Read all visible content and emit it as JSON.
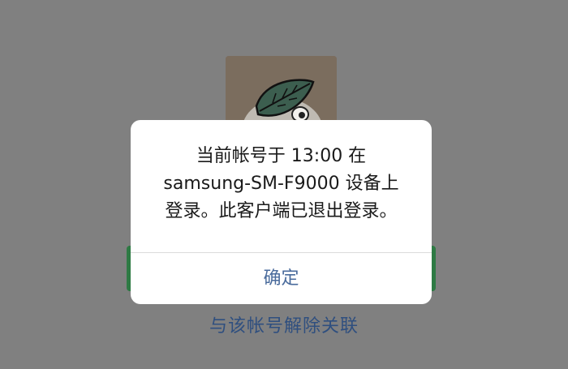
{
  "dialog": {
    "message_lines": [
      "当前帐号于 13:00 在",
      "samsung-SM-F9000 设备上",
      "登录。此客户端已退出登录。"
    ],
    "confirm_label": "确定"
  },
  "background": {
    "unlink_label": "与该帐号解除关联",
    "accent_color": "#2e7a44",
    "link_color": "#2f4f7f"
  },
  "icons": {
    "avatar": "leaf-cartoon-avatar-icon"
  }
}
